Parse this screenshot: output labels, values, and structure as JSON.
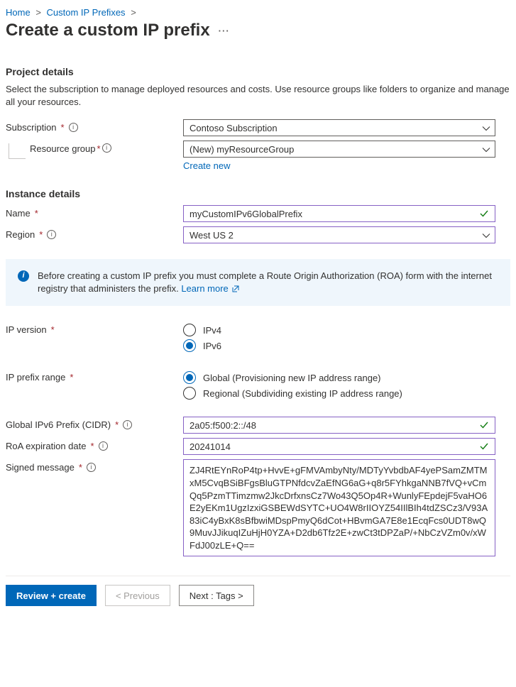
{
  "breadcrumb": {
    "home": "Home",
    "list": "Custom IP Prefixes"
  },
  "page_title": "Create a custom IP prefix",
  "project": {
    "title": "Project details",
    "desc": "Select the subscription to manage deployed resources and costs. Use resource groups like folders to organize and manage all your resources.",
    "subscription_label": "Subscription",
    "subscription_value": "Contoso Subscription",
    "rg_label": "Resource group",
    "rg_value": "(New) myResourceGroup",
    "create_new": "Create new"
  },
  "instance": {
    "title": "Instance details",
    "name_label": "Name",
    "name_value": "myCustomIPv6GlobalPrefix",
    "region_label": "Region",
    "region_value": "West US 2"
  },
  "banner": {
    "text": "Before creating a custom IP prefix you must complete a Route Origin Authorization (ROA) form with the internet registry that administers the prefix. ",
    "learn": "Learn more"
  },
  "ipversion": {
    "label": "IP version",
    "opt1": "IPv4",
    "opt2": "IPv6",
    "selected": "IPv6"
  },
  "iprange": {
    "label": "IP prefix range",
    "opt1": "Global (Provisioning new IP address range)",
    "opt2": "Regional (Subdividing existing IP address range)",
    "selected": "Global"
  },
  "cidr": {
    "label": "Global IPv6 Prefix (CIDR)",
    "value": "2a05:f500:2::/48"
  },
  "roa": {
    "label": "RoA expiration date",
    "value": "20241014"
  },
  "signed": {
    "label": "Signed message",
    "value": "ZJ4RtEYnRoP4tp+HvvE+gFMVAmbyNty/MDTyYvbdbAF4yePSamZMTMxM5CvqBSiBFgsBluGTPNfdcvZaEfNG6aG+q8r5FYhkgaNNB7fVQ+vCmQq5PzmTTimzmw2JkcDrfxnsCz7Wo43Q5Op4R+WunlyFEpdejF5vaHO6E2yEKm1UgzIzxiGSBEWdSYTC+UO4W8rIIOYZ54IIlBIh4tdZSCz3/V93A83iC4yBxK8sBfbwiMDspPmyQ6dCot+HBvmGA7E8e1EcqFcs0UDT8wQ9MuvJJikuqIZuHjH0YZA+D2db6Tfz2E+zwCt3tDPZaP/+NbCzVZm0v/xWFdJ00zLE+Q=="
  },
  "buttons": {
    "review": "Review + create",
    "prev": "< Previous",
    "next": "Next : Tags >"
  }
}
